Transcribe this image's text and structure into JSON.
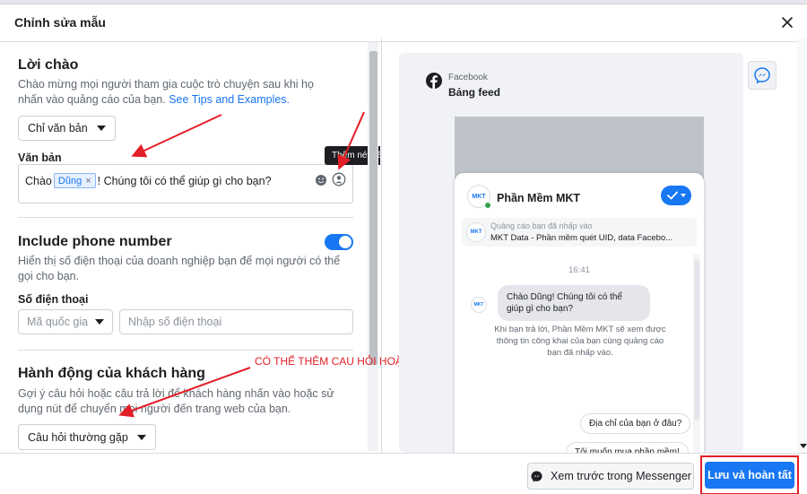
{
  "modal": {
    "title": "Chỉnh sửa mẫu"
  },
  "greeting": {
    "title": "Lời chào",
    "description": "Chào mừng mọi người tham gia cuộc trò chuyện sau khi họ nhấn vào quảng cáo của bạn.",
    "link_text": "See Tips and Examples.",
    "type_dropdown": "Chỉ văn bản",
    "text_label": "Văn bản",
    "text_before": "Chào",
    "token": "Dũng",
    "text_after": "! Chúng tôi có thể giúp gì cho bạn?",
    "tooltip": "Thêm nét riêng"
  },
  "phone": {
    "title": "Include phone number",
    "description": "Hiển thị số điện thoại của doanh nghiệp bạn để mọi người có thể gọi cho bạn.",
    "label": "Số điện thoại",
    "country_placeholder": "Mã quốc gia",
    "number_placeholder": "Nhập số điện thoại",
    "toggle_on": true
  },
  "actions": {
    "title": "Hành động của khách hàng",
    "description": "Gợi ý câu hỏi hoặc câu trả lời để khách hàng nhấn vào hoặc sử dụng nút để chuyển mọi người đến trang web của bạn.",
    "dropdown": "Câu hỏi thường gặp"
  },
  "annotation": {
    "text": "CÓ THỂ THÊM CAU HỎI HOẶC KHÔNG",
    "color": "#e41e26"
  },
  "preview": {
    "platform": "Facebook",
    "placement": "Bảng feed",
    "page_name": "Phần Mềm MKT",
    "logo_text": "MKT",
    "ad_subtitle": "Quảng cáo bạn đã nhấp vào",
    "ad_title": "MKT Data - Phần mềm quét UID, data Facebo...",
    "time": "16:41",
    "greeting_message": "Chào Dũng! Chúng tôi có thể giúp gì cho bạn?",
    "info_text": "Khi bạn trả lời, Phần Mềm MKT sẽ xem được thông tin công khai của bạn cùng quảng cáo bạn đã nhấp vào.",
    "reply_1": "Địa chỉ của bạn ở đâu?",
    "reply_2": "Tôi muốn mua phần mềm!"
  },
  "footer": {
    "preview_button": "Xem trước trong Messenger",
    "save_button": "Lưu và hoàn tất"
  },
  "colors": {
    "accent": "#1877f2",
    "annotation": "#e41e26"
  }
}
